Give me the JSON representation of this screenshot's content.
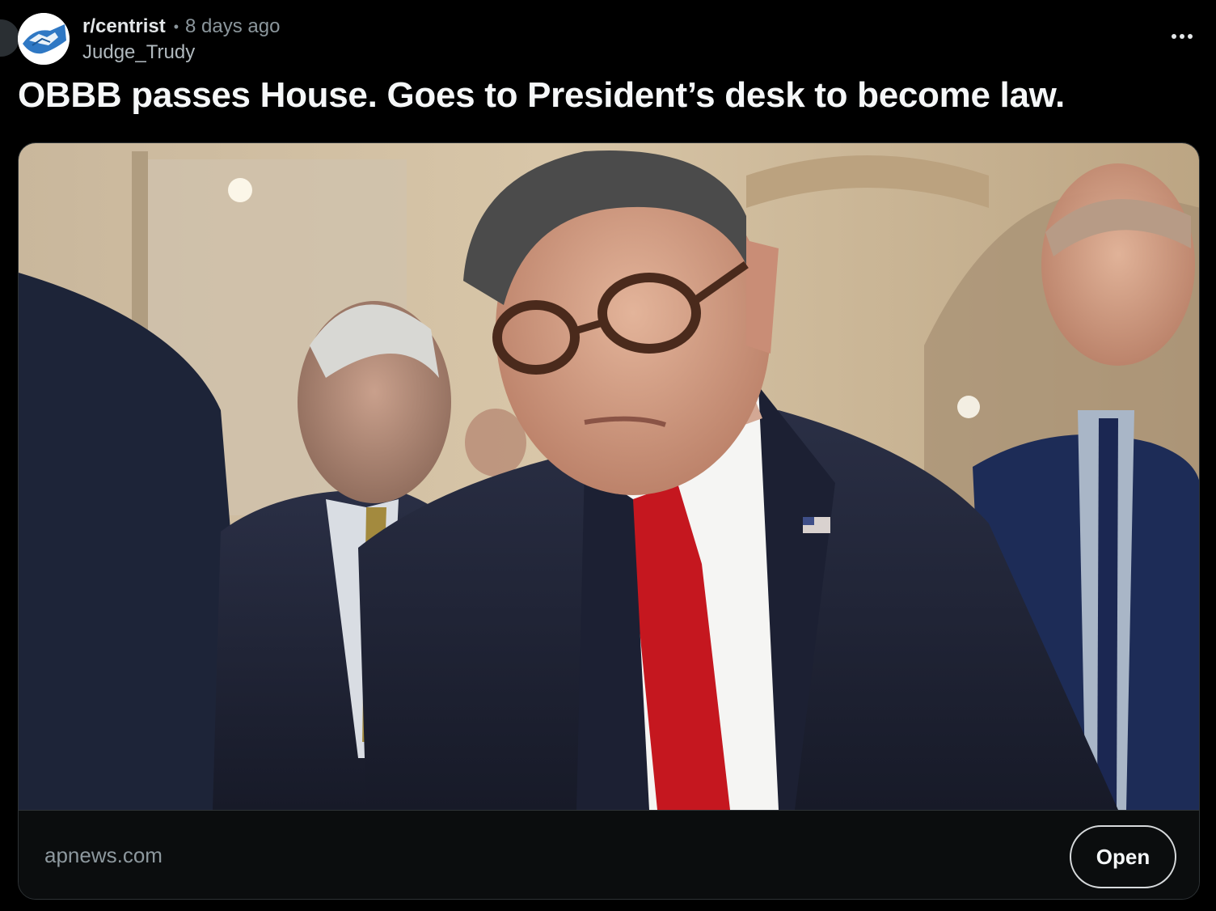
{
  "post": {
    "subreddit": "r/centrist",
    "separator": "•",
    "time_ago": "8 days ago",
    "author": "Judge_Trudy",
    "title": "OBBB passes House. Goes to President’s desk to become law.",
    "more_icon": "more-horizontal-icon"
  },
  "community": {
    "avatar_icon": "handshake-icon",
    "avatar_colors": {
      "background": "#ffffff",
      "accent": "#2f78c4"
    }
  },
  "link_card": {
    "domain": "apnews.com",
    "open_label": "Open",
    "image_alt": "Man in dark suit and red tie looking down, surrounded by others in a hallway"
  },
  "colors": {
    "background": "#000000",
    "card_border": "#2e3336",
    "title_text": "#f5f7f8",
    "muted_text": "#8b969c"
  }
}
